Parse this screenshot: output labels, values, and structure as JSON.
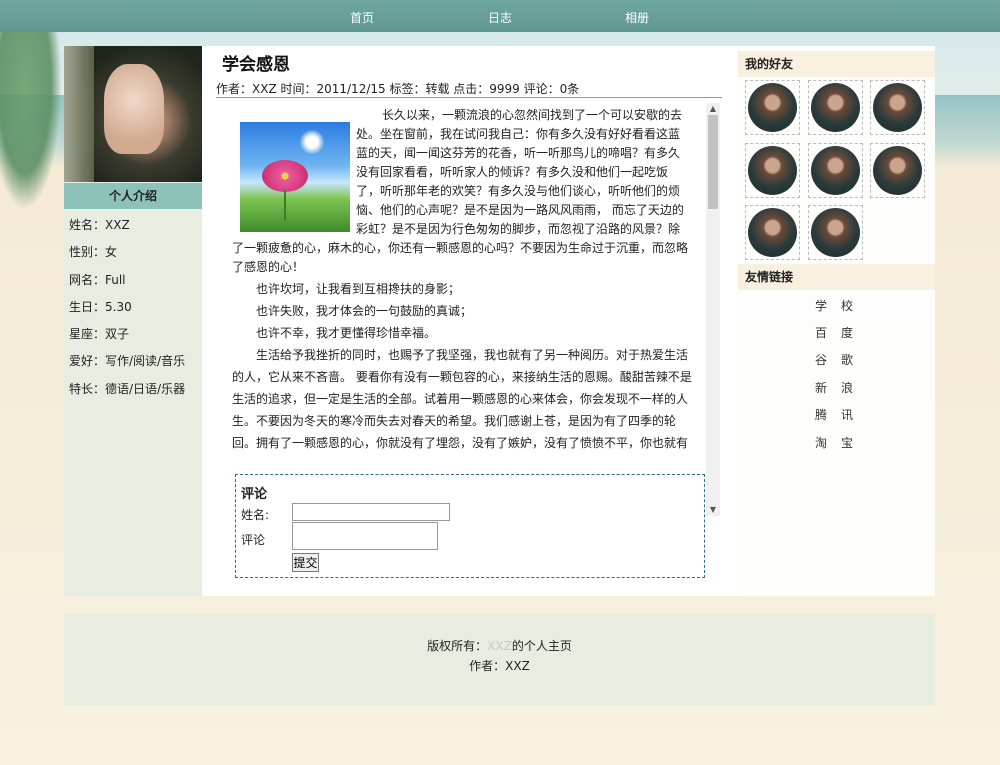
{
  "nav": {
    "items": [
      "首页",
      "日志",
      "相册"
    ]
  },
  "profile": {
    "section_title": "个人介绍",
    "fields": [
      "姓名：XXZ",
      "性别：女",
      "网名：Full",
      "生日：5.30",
      "星座：双子",
      "爱好：写作/阅读/音乐",
      "特长：德语/日语/乐器"
    ]
  },
  "article": {
    "title": "学会感恩",
    "meta": "作者：XXZ 时间：2011/12/15 标签：转载 点击：9999 评论：0条",
    "lines_wrapped": [
      "长久以来，一颗流浪的心忽然间找到了一个可以安歇的去",
      "处。坐在窗前，我在试问我自己：你有多久没有好好看看这蓝",
      "蓝的天，闻一闻这芬芳的花香，听一听那鸟儿的啼唱？有多久",
      "没有回家看看，听听家人的倾诉？有多久没和他们一起吃饭",
      "了，听听那年老的欢笑？有多久没与他们谈心，听听他们的烦",
      "恼、他们的心声呢？是不是因为一路风风雨雨， 而忘了天边的",
      "彩虹？是不是因为行色匆匆的脚步，而忽视了沿路的风景？除"
    ],
    "lines_full": [
      "了一颗疲惫的心，麻木的心，你还有一颗感恩的心吗？不要因为生命过于沉重，而忽略",
      "了感恩的心！",
      "也许坎坷，让我看到互相搀扶的身影；",
      "也许失败，我才体会的一句鼓励的真诚；",
      "也许不幸，我才更懂得珍惜幸福。",
      "生活给予我挫折的同时，也赐予了我坚强，我也就有了另一种阅历。对于热爱生活",
      "的人，它从来不吝啬。 要看你有没有一颗包容的心，来接纳生活的恩赐。酸甜苦辣不是",
      "生活的追求，但一定是生活的全部。试着用一颗感恩的心来体会，你会发现不一样的人",
      "生。不要因为冬天的寒冷而失去对春天的希望。我们感谢上苍，是因为有了四季的轮",
      "回。拥有了一颗感恩的心，你就没有了埋怨，没有了嫉妒，没有了愤愤不平，你也就有"
    ]
  },
  "comment": {
    "title": "评论",
    "name_label": "姓名:",
    "comment_label": "评论",
    "name_value": "",
    "comment_value": "",
    "submit_label": "提交"
  },
  "friends": {
    "title": "我的好友",
    "count": 8
  },
  "links": {
    "title": "友情链接",
    "items": [
      "学校",
      "百度",
      "谷歌",
      "新浪",
      "腾讯",
      "淘宝"
    ]
  },
  "footer": {
    "copyright_prefix": "版权所有：",
    "owner": "XXZ",
    "copyright_suffix": "的个人主页",
    "author": "作者：XXZ"
  }
}
